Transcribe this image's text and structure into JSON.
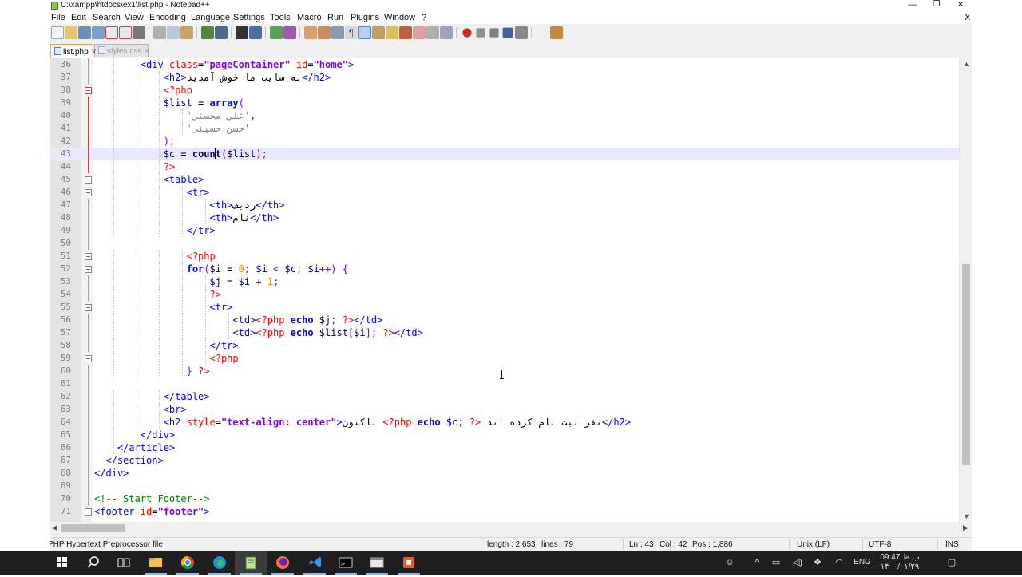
{
  "window": {
    "title": "C:\\xampp\\htdocs\\ex1\\list.php - Notepad++",
    "controls": {
      "minimize": "—",
      "restore": "❐",
      "close": "✕"
    },
    "menubar_close": "X"
  },
  "menu": [
    "File",
    "Edit",
    "Search",
    "View",
    "Encoding",
    "Language",
    "Settings",
    "Tools",
    "Macro",
    "Run",
    "Plugins",
    "Window",
    "?"
  ],
  "tabs": [
    {
      "label": "list.php",
      "active": true,
      "close": "✕"
    },
    {
      "label": "styles.css",
      "active": false,
      "close": "✕"
    }
  ],
  "editor": {
    "first_line_number": 36,
    "current_line": 43,
    "lines": [
      {
        "n": "36",
        "t": [
          [
            "        ",
            "p"
          ],
          [
            "<div ",
            "tag"
          ],
          [
            "class",
            "attr"
          ],
          [
            "=",
            "p"
          ],
          [
            "\"pageContainer\"",
            "str"
          ],
          [
            " ",
            "p"
          ],
          [
            "id",
            "attr"
          ],
          [
            "=",
            "p"
          ],
          [
            "\"home\"",
            "str"
          ],
          [
            ">",
            "tag"
          ]
        ]
      },
      {
        "n": "37",
        "t": [
          [
            "            ",
            "p"
          ],
          [
            "<h2>",
            "tag"
          ],
          [
            "به سایت ما خوش آمدید",
            "rtl"
          ],
          [
            "</h2>",
            "tag"
          ]
        ]
      },
      {
        "n": "38",
        "t": [
          [
            "            ",
            "p"
          ],
          [
            "<?php",
            "php"
          ]
        ]
      },
      {
        "n": "39",
        "t": [
          [
            "            ",
            "p"
          ],
          [
            "$list",
            "var"
          ],
          [
            " = ",
            "p"
          ],
          [
            "array",
            "kw"
          ],
          [
            "(",
            "op"
          ]
        ]
      },
      {
        "n": "40",
        "t": [
          [
            "                ",
            "p"
          ],
          [
            "'علی محسنی'",
            "phpstr"
          ],
          [
            ",",
            "op"
          ]
        ]
      },
      {
        "n": "41",
        "t": [
          [
            "                ",
            "p"
          ],
          [
            "'حسن حسینی'",
            "phpstr"
          ]
        ]
      },
      {
        "n": "42",
        "t": [
          [
            "            ",
            "p"
          ],
          [
            ");",
            "op"
          ]
        ]
      },
      {
        "n": "43",
        "t": [
          [
            "            ",
            "p"
          ],
          [
            "$c",
            "var"
          ],
          [
            " = ",
            "p"
          ],
          [
            "coun",
            "fn"
          ],
          [
            "",
            "caret"
          ],
          [
            "t",
            "fn"
          ],
          [
            "(",
            "op"
          ],
          [
            "$list",
            "var"
          ],
          [
            ");",
            "op"
          ]
        ]
      },
      {
        "n": "44",
        "t": [
          [
            "            ",
            "p"
          ],
          [
            "?>",
            "php"
          ]
        ]
      },
      {
        "n": "45",
        "t": [
          [
            "            ",
            "p"
          ],
          [
            "<table>",
            "tag"
          ]
        ]
      },
      {
        "n": "46",
        "t": [
          [
            "                ",
            "p"
          ],
          [
            "<tr>",
            "tag"
          ]
        ]
      },
      {
        "n": "47",
        "t": [
          [
            "                    ",
            "p"
          ],
          [
            "<th>",
            "tag"
          ],
          [
            "ردیف",
            "rtl"
          ],
          [
            "</th>",
            "tag"
          ]
        ]
      },
      {
        "n": "48",
        "t": [
          [
            "                    ",
            "p"
          ],
          [
            "<th>",
            "tag"
          ],
          [
            "نام",
            "rtl"
          ],
          [
            "</th>",
            "tag"
          ]
        ]
      },
      {
        "n": "49",
        "t": [
          [
            "                ",
            "p"
          ],
          [
            "</tr>",
            "tag"
          ]
        ]
      },
      {
        "n": "50",
        "t": []
      },
      {
        "n": "51",
        "t": [
          [
            "                ",
            "p"
          ],
          [
            "<?php",
            "php"
          ]
        ]
      },
      {
        "n": "52",
        "t": [
          [
            "                ",
            "p"
          ],
          [
            "for",
            "kw"
          ],
          [
            "(",
            "op"
          ],
          [
            "$i",
            "var"
          ],
          [
            " = ",
            "p"
          ],
          [
            "0",
            "num"
          ],
          [
            "; ",
            "op"
          ],
          [
            "$i",
            "var"
          ],
          [
            " < ",
            "op"
          ],
          [
            "$c",
            "var"
          ],
          [
            "; ",
            "op"
          ],
          [
            "$i",
            "var"
          ],
          [
            "++) {",
            "op"
          ]
        ]
      },
      {
        "n": "53",
        "t": [
          [
            "                    ",
            "p"
          ],
          [
            "$j",
            "var"
          ],
          [
            " = ",
            "p"
          ],
          [
            "$i",
            "var"
          ],
          [
            " + ",
            "op"
          ],
          [
            "1",
            "num"
          ],
          [
            ";",
            "op"
          ]
        ]
      },
      {
        "n": "54",
        "t": [
          [
            "                    ",
            "p"
          ],
          [
            "?>",
            "php"
          ]
        ]
      },
      {
        "n": "55",
        "t": [
          [
            "                    ",
            "p"
          ],
          [
            "<tr>",
            "tag"
          ]
        ]
      },
      {
        "n": "56",
        "t": [
          [
            "                        ",
            "p"
          ],
          [
            "<td>",
            "tag"
          ],
          [
            "<?php",
            "php"
          ],
          [
            " ",
            "p"
          ],
          [
            "echo",
            "kw"
          ],
          [
            " ",
            "p"
          ],
          [
            "$j",
            "var"
          ],
          [
            "; ",
            "op"
          ],
          [
            "?>",
            "php"
          ],
          [
            "</td>",
            "tag"
          ]
        ]
      },
      {
        "n": "57",
        "t": [
          [
            "                        ",
            "p"
          ],
          [
            "<td>",
            "tag"
          ],
          [
            "<?php",
            "php"
          ],
          [
            " ",
            "p"
          ],
          [
            "echo",
            "kw"
          ],
          [
            " ",
            "p"
          ],
          [
            "$list",
            "var"
          ],
          [
            "[",
            "op"
          ],
          [
            "$i",
            "var"
          ],
          [
            "]; ",
            "op"
          ],
          [
            "?>",
            "php"
          ],
          [
            "</td>",
            "tag"
          ]
        ]
      },
      {
        "n": "58",
        "t": [
          [
            "                    ",
            "p"
          ],
          [
            "</tr>",
            "tag"
          ]
        ]
      },
      {
        "n": "59",
        "t": [
          [
            "                    ",
            "p"
          ],
          [
            "<?php",
            "php"
          ]
        ]
      },
      {
        "n": "60",
        "t": [
          [
            "                ",
            "p"
          ],
          [
            "} ",
            "op"
          ],
          [
            "?>",
            "php"
          ]
        ]
      },
      {
        "n": "61",
        "t": []
      },
      {
        "n": "62",
        "t": [
          [
            "            ",
            "p"
          ],
          [
            "</table>",
            "tag"
          ]
        ]
      },
      {
        "n": "63",
        "t": [
          [
            "            ",
            "p"
          ],
          [
            "<br>",
            "tag"
          ]
        ]
      },
      {
        "n": "64",
        "t": [
          [
            "            ",
            "p"
          ],
          [
            "<h2 ",
            "tag"
          ],
          [
            "style",
            "attr"
          ],
          [
            "=",
            "p"
          ],
          [
            "\"text-align: center\"",
            "str"
          ],
          [
            ">",
            "tag"
          ],
          [
            "تاکنون",
            "rtl"
          ],
          [
            " ",
            "p"
          ],
          [
            "<?php",
            "php"
          ],
          [
            " ",
            "p"
          ],
          [
            "echo",
            "kw"
          ],
          [
            " ",
            "p"
          ],
          [
            "$c",
            "var"
          ],
          [
            "; ",
            "op"
          ],
          [
            "?>",
            "php"
          ],
          [
            " ",
            "p"
          ],
          [
            "نفر ثبت نام کرده اند",
            "rtl"
          ],
          [
            "</h2>",
            "tag"
          ]
        ]
      },
      {
        "n": "65",
        "t": [
          [
            "        ",
            "p"
          ],
          [
            "</div>",
            "tag"
          ]
        ]
      },
      {
        "n": "66",
        "t": [
          [
            "    ",
            "p"
          ],
          [
            "</article>",
            "tag"
          ]
        ]
      },
      {
        "n": "67",
        "t": [
          [
            "  ",
            "p"
          ],
          [
            "</section>",
            "tag"
          ]
        ]
      },
      {
        "n": "68",
        "t": [
          [
            "</div>",
            "tag"
          ]
        ]
      },
      {
        "n": "69",
        "t": []
      },
      {
        "n": "70",
        "t": [
          [
            "<!-- Start Footer-->",
            "cmt"
          ]
        ]
      },
      {
        "n": "71",
        "t": [
          [
            "<footer ",
            "tag"
          ],
          [
            "id",
            "attr"
          ],
          [
            "=",
            "p"
          ],
          [
            "\"footer\"",
            "str"
          ],
          [
            ">",
            "tag"
          ]
        ]
      }
    ]
  },
  "colors": {
    "tag": "#0000ff",
    "attr": "#ff0000",
    "str": "#8000ff",
    "php": "#ff0000",
    "var": "#000080",
    "kw": "#0000ff",
    "op": "#8000ff",
    "num": "#ff8000",
    "phpstr": "#808080",
    "cmt": "#008000",
    "line_highlight": "#e8e8ff"
  },
  "status": {
    "file_type": "PHP Hypertext Preprocessor file",
    "length": "length : 2,653",
    "lines": "lines : 79",
    "ln": "Ln : 43",
    "col": "Col : 42",
    "pos": "Pos : 1,886",
    "eol": "Unix (LF)",
    "encoding": "UTF-8",
    "mode": "INS"
  },
  "taskbar": {
    "apps": [
      "start",
      "search",
      "task-view",
      "file-explorer",
      "chrome",
      "edge",
      "notepad-plus-plus",
      "firefox",
      "vscode",
      "terminal",
      "app-window",
      "app-orange"
    ],
    "language": "ENG",
    "time": "09:47 ب.ظ",
    "date": "۱۴۰۰/۰۱/۲۹"
  }
}
